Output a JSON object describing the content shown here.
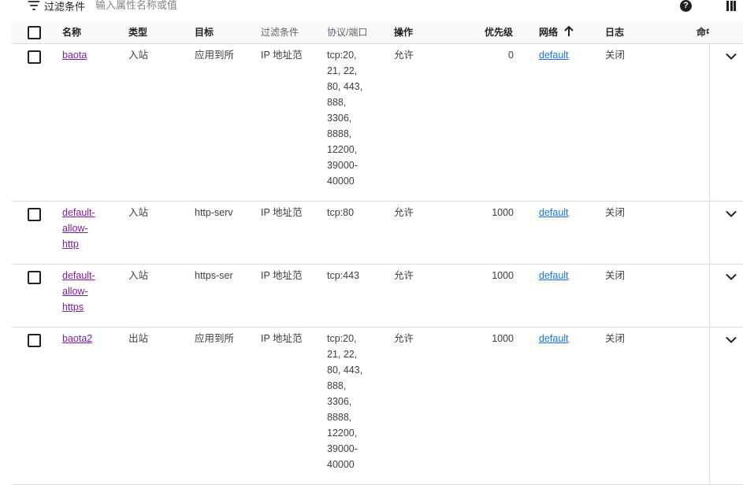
{
  "toolbar": {
    "filter_label": "过滤条件",
    "filter_placeholder": "输入属性名称或值"
  },
  "columns": {
    "name": "名称",
    "type": "类型",
    "target": "目标",
    "filter": "过滤条件",
    "protocol": "协议/端口",
    "action": "操作",
    "priority": "优先级",
    "network": "网络",
    "log": "日志",
    "hit": "命中"
  },
  "rows": [
    {
      "name_lines": [
        "baota"
      ],
      "type": "入站",
      "target": "应用到所",
      "filter": "IP 地址范",
      "protocol_lines": [
        "tcp:20,",
        "21, 22,",
        "80, 443,",
        "888,",
        "3306,",
        "8888,",
        "12200,",
        "39000-",
        "40000"
      ],
      "action": "允许",
      "priority": "0",
      "network": "default",
      "log": "关闭"
    },
    {
      "name_lines": [
        "default-",
        "allow-",
        "http"
      ],
      "type": "入站",
      "target": "http-serv",
      "filter": "IP 地址范",
      "protocol_lines": [
        "tcp:80"
      ],
      "action": "允许",
      "priority": "1000",
      "network": "default",
      "log": "关闭"
    },
    {
      "name_lines": [
        "default-",
        "allow-",
        "https"
      ],
      "type": "入站",
      "target": "https-ser",
      "filter": "IP 地址范",
      "protocol_lines": [
        "tcp:443"
      ],
      "action": "允许",
      "priority": "1000",
      "network": "default",
      "log": "关闭"
    },
    {
      "name_lines": [
        "baota2"
      ],
      "type": "出站",
      "target": "应用到所",
      "filter": "IP 地址范",
      "protocol_lines": [
        "tcp:20,",
        "21, 22,",
        "80, 443,",
        "888,",
        "3306,",
        "8888,",
        "12200,",
        "39000-",
        "40000"
      ],
      "action": "允许",
      "priority": "1000",
      "network": "default",
      "log": "关闭"
    }
  ],
  "icons": {
    "filter": "filter-list-icon",
    "help": "help-icon",
    "columns": "column-display-icon",
    "sort": "arrow-upward-icon",
    "expand": "chevron-down-icon"
  },
  "colors": {
    "link": "#1a73e8",
    "visited_link": "#7b1fa2",
    "text": "#3c4043",
    "divider": "#dadce0"
  }
}
